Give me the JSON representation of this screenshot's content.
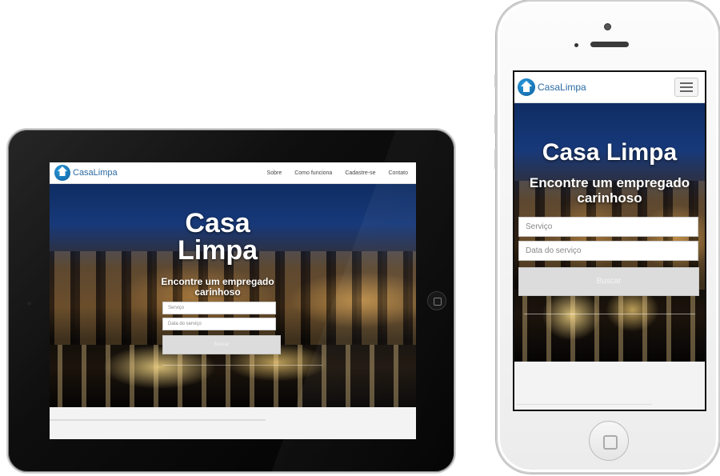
{
  "site": {
    "logo_text": "CasaLimpa",
    "hero_title": "Casa Limpa",
    "hero_subtitle": "Encontre um empregado carinhoso",
    "service_placeholder": "Serviço",
    "date_placeholder": "Data do serviço",
    "search_label": "Buscar"
  },
  "tablet": {
    "menu": [
      {
        "label": "Sobre"
      },
      {
        "label": "Como funciona"
      },
      {
        "label": "Cadastre-se"
      },
      {
        "label": "Contato"
      }
    ]
  },
  "colors": {
    "brand_blue": "#2a6aa3",
    "button_gray": "#dcdcdc"
  },
  "icons": {
    "logo": "house-logo-icon",
    "menu_toggle": "hamburger-menu-icon"
  }
}
